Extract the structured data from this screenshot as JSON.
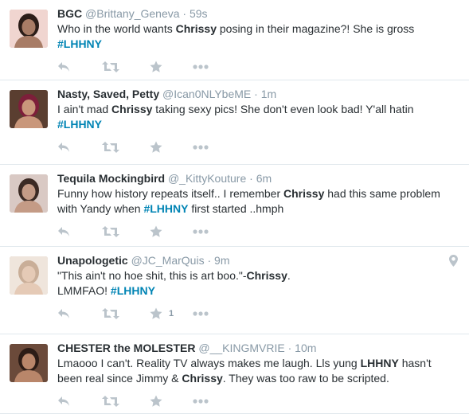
{
  "tweets": [
    {
      "fullname": "BGC",
      "screen_name": "@Brittany_Geneva",
      "separator": "·",
      "time": "59s",
      "text_parts": [
        {
          "t": "Who in the world wants ",
          "s": "plain"
        },
        {
          "t": "Chrissy",
          "s": "bold"
        },
        {
          "t": " posing in their magazine?! She is gross",
          "s": "plain"
        },
        {
          "t": "#LHHNY",
          "s": "tag",
          "br": true
        }
      ],
      "favorite_count": ""
    },
    {
      "fullname": "Nasty, Saved, Petty",
      "screen_name": "@Ican0NLYbeME",
      "separator": "·",
      "time": "1m",
      "text_parts": [
        {
          "t": "I ain't mad ",
          "s": "plain"
        },
        {
          "t": "Chrissy",
          "s": "bold"
        },
        {
          "t": " taking sexy pics! She don't even look bad! Y'all hatin",
          "s": "plain"
        },
        {
          "t": "#LHHNY",
          "s": "tag",
          "br": true
        }
      ],
      "favorite_count": ""
    },
    {
      "fullname": "Tequila Mockingbird",
      "screen_name": "@_KittyKouture",
      "separator": "·",
      "time": "6m",
      "text_parts": [
        {
          "t": "Funny how history repeats itself.. I remember ",
          "s": "plain"
        },
        {
          "t": "Chrissy",
          "s": "bold"
        },
        {
          "t": " had this same problem",
          "s": "plain"
        },
        {
          "t": "with Yandy when ",
          "s": "plain",
          "br": true
        },
        {
          "t": "#LHHNY",
          "s": "tag"
        },
        {
          "t": " first started ..hmph",
          "s": "plain"
        }
      ],
      "favorite_count": ""
    },
    {
      "fullname": "Unapologetic",
      "screen_name": "@JC_MarQuis",
      "separator": "·",
      "time": "9m",
      "text_parts": [
        {
          "t": "\"This ain't no hoe shit, this is art boo.\"-",
          "s": "plain"
        },
        {
          "t": "Chrissy",
          "s": "bold"
        },
        {
          "t": ".",
          "s": "plain"
        },
        {
          "t": "LMMFAO! ",
          "s": "plain",
          "br": true
        },
        {
          "t": "#LHHNY",
          "s": "tag"
        }
      ],
      "favorite_count": "1",
      "has_location_icon": true
    },
    {
      "fullname": "CHESTER the MOLESTER",
      "screen_name": "@__KINGMVRIE",
      "separator": "·",
      "time": "10m",
      "text_parts": [
        {
          "t": "Lmaooo I can't. Reality TV always makes me laugh. Lls yung ",
          "s": "plain"
        },
        {
          "t": "LHHNY",
          "s": "bold"
        },
        {
          "t": " hasn't",
          "s": "plain"
        },
        {
          "t": "been real since Jimmy & ",
          "s": "plain",
          "br": true
        },
        {
          "t": "Chrissy",
          "s": "bold"
        },
        {
          "t": ". They was too raw to be scripted.",
          "s": "plain"
        }
      ],
      "favorite_count": ""
    }
  ],
  "icons": {
    "reply": "reply-icon",
    "retweet": "retweet-icon",
    "favorite": "star-icon",
    "more": "more-icon",
    "location": "location-pin-icon"
  },
  "colors": {
    "hashtag": "#0084b4",
    "meta": "#8899a6",
    "text": "#292f33",
    "action_icon": "#bbc4cb",
    "divider": "#e1e8ed"
  }
}
